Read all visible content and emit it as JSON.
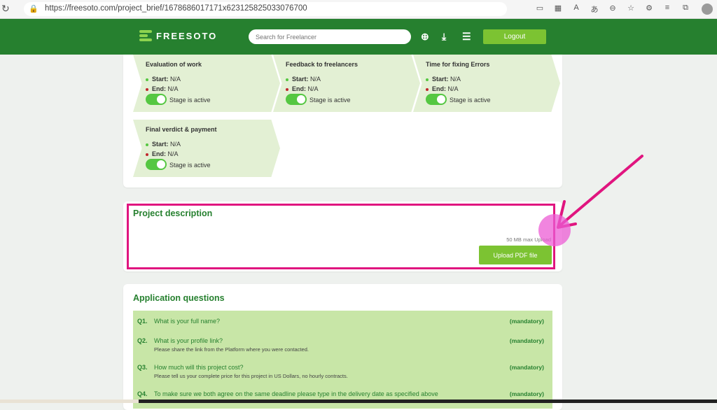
{
  "browser": {
    "url": "https://freesoto.com/project_brief/1678686017171x623125825033076700"
  },
  "nav": {
    "logo": "FREESOTO",
    "search_placeholder": "Search for Freelancer",
    "logout_label": "Logout"
  },
  "stages": [
    {
      "title": "Evaluation of work",
      "start_label": "Start:",
      "start": "N/A",
      "end_label": "End:",
      "end": "N/A",
      "status": "Stage is active"
    },
    {
      "title": "Feedback to freelancers",
      "start_label": "Start:",
      "start": "N/A",
      "end_label": "End:",
      "end": "N/A",
      "status": "Stage is active"
    },
    {
      "title": "Time for fixing Errors",
      "start_label": "Start:",
      "start": "N/A",
      "end_label": "End:",
      "end": "N/A",
      "status": "Stage is active"
    },
    {
      "title": "Final verdict & payment",
      "start_label": "Start:",
      "start": "N/A",
      "end_label": "End:",
      "end": "N/A",
      "status": "Stage is active"
    }
  ],
  "project_description": {
    "title": "Project description",
    "max_upload": "50 MB max Upload",
    "upload_label": "Upload PDF file"
  },
  "application_questions": {
    "title": "Application questions",
    "items": [
      {
        "num": "Q1.",
        "text": "What is your full name?",
        "sub": "",
        "tag": "(mandatory)"
      },
      {
        "num": "Q2.",
        "text": "What is your profile link?",
        "sub": "Please share the link from the Platform where you were contacted.",
        "tag": "(mandatory)"
      },
      {
        "num": "Q3.",
        "text": "How much will this project cost?",
        "sub": "Please tell us your complete price for this project in US Dollars, no hourly contracts.",
        "tag": "(mandatory)"
      },
      {
        "num": "Q4.",
        "text": "To make sure we both agree on the same deadline please type in the delivery date as specified above",
        "sub": "",
        "tag": "(mandatory)"
      }
    ]
  },
  "colors": {
    "brand_green": "#26802f",
    "accent_green": "#7cc332",
    "stage_bg": "#e3f0d4",
    "question_bg": "#c8e6a7",
    "highlight": "#e0157f"
  }
}
